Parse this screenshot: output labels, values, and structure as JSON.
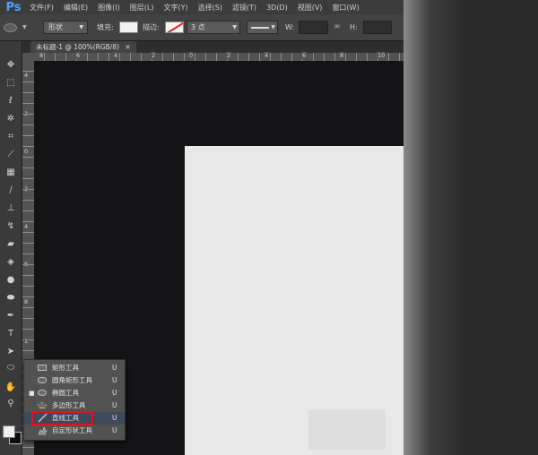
{
  "app": {
    "logo": "Ps"
  },
  "menu": [
    "文件(F)",
    "编辑(E)",
    "图像(I)",
    "图层(L)",
    "文字(Y)",
    "选择(S)",
    "滤镜(T)",
    "3D(D)",
    "视图(V)",
    "窗口(W)"
  ],
  "options": {
    "mode": "形状",
    "fill_label": "填充:",
    "stroke_label": "描边:",
    "stroke_width": "3 点",
    "w_label": "W:",
    "h_label": "H:",
    "fill_color": "#f2f2f2",
    "stroke_color": "#e02020"
  },
  "document": {
    "tab_title": "未标题-1 @ 100%(RGB/8)",
    "tab_close": "×",
    "ruler_h": [
      "8",
      "6",
      "4",
      "2",
      "0",
      "2",
      "4",
      "6",
      "8",
      "10"
    ],
    "ruler_v": [
      "4",
      "2",
      "0",
      "2",
      "4",
      "6",
      "8",
      "1"
    ]
  },
  "toolbar": {
    "tools": [
      "move-tool",
      "marquee-tool",
      "lasso-tool",
      "quick-select-tool",
      "crop-tool",
      "eyedropper-tool",
      "healing-brush-tool",
      "brush-tool",
      "clone-stamp-tool",
      "history-brush-tool",
      "eraser-tool",
      "gradient-tool",
      "blur-tool",
      "dodge-tool",
      "pen-tool",
      "type-tool",
      "path-select-tool",
      "ellipse-tool",
      "hand-tool",
      "zoom-tool"
    ]
  },
  "shape_flyout": {
    "items": [
      {
        "label": "矩形工具",
        "key": "U",
        "icon": "rectangle-icon",
        "active": false
      },
      {
        "label": "圆角矩形工具",
        "key": "U",
        "icon": "rounded-rectangle-icon",
        "active": false
      },
      {
        "label": "椭圆工具",
        "key": "U",
        "icon": "ellipse-icon",
        "active": true
      },
      {
        "label": "多边形工具",
        "key": "U",
        "icon": "polygon-icon",
        "active": false
      },
      {
        "label": "直线工具",
        "key": "U",
        "icon": "line-icon",
        "active": false,
        "highlighted": true
      },
      {
        "label": "自定形状工具",
        "key": "U",
        "icon": "custom-shape-icon",
        "active": false
      }
    ]
  },
  "colors": {
    "foreground": "#f0f0f0",
    "background": "#0e0e0e",
    "highlight": "#e4131b"
  }
}
